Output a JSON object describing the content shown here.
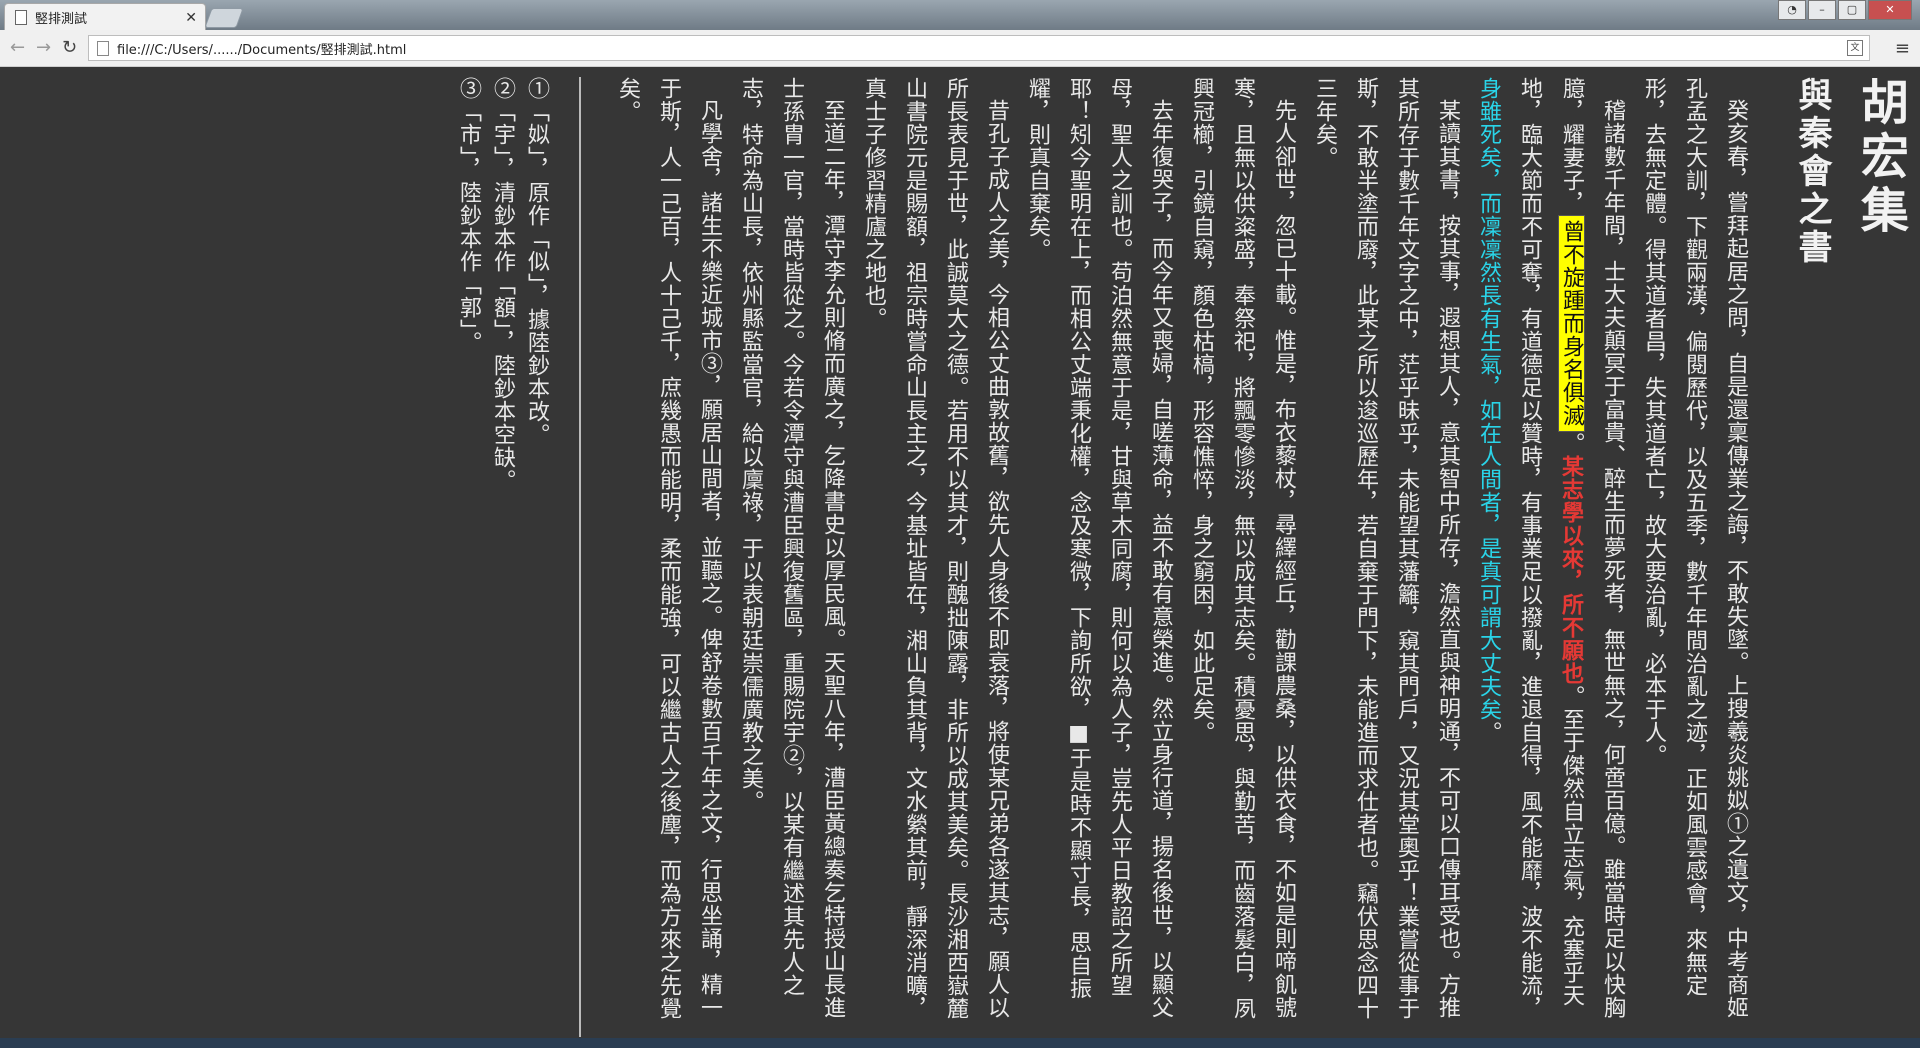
{
  "window": {
    "tab_title": "竪排測試",
    "address": "file:///C:/Users/....../Documents/竪排測試.html"
  },
  "doc": {
    "title": "胡宏集",
    "subtitle": "與秦會之書",
    "p1": "癸亥春，嘗拜起居之問，自是還稟傳業之誨，不敢失墜。上搜羲炎姚姒①之遺文，中考商姬孔孟之大訓，下觀兩漢，偏閱歷代，以及五季，數千年間治亂之迹，正如風雲感會，來無定形，去無定體。得其道者昌，失其道者亡，故大要治亂，必本于人。",
    "p2_a": "稽諸數千年間，士大夫顛冥于富貴、醉生而夢死者，無世無之，何啻百億。雖當時足以快胸臆，耀妻子，",
    "p2_highlight": "曾不旋踵而身名俱滅",
    "p2_b": "。",
    "p2_red": "某志學以來，所不願也",
    "p2_c": "。至于傑然自立志氣，充塞乎天地，臨大節而不可奪，有道德足以贊時，有事業足以撥亂，進退自得，風不能靡，波不能流，",
    "p2_cyan": "身雖死矣，而凜凜然長有生氣，如在人間者，是真可謂大丈夫矣",
    "p2_d": "。",
    "p3": "某讀其書，按其事，遐想其人，意其智中所存，澹然直與神明通，不可以口傳耳受也。方推其所存于數千年文字之中，茫乎昧乎，未能望其藩籬，窺其門戶，又況其堂奧乎！業嘗從事于斯，不敢半塗而廢，此某之所以逡巡歷年，若自棄于門下，未能進而求仕者也。竊伏思念四十三年矣。",
    "p4": "先人卻世，忽已十載。惟是，布衣藜杖，尋繹經丘，勸課農桑，以供衣食，不如是則啼飢號寒，且無以供粢盛，奉祭祀，將飄零慘淡，無以成其志矣。積憂思，與勤苦，而齒落髮白，夙興冠櫛，引鏡自窺，顏色枯槁，形容憔悴，身之窮困，如此足矣。",
    "p5": "去年復哭子，而今年又喪婦，自嗟薄命，益不敢有意榮進。然立身行道，揚名後世，以顯父母，聖人之訓也。苟泊然無意于是，甘與草木同腐，則何以為人子，豈先人平日教詔之所望耶！矧今聖明在上，而相公丈端秉化權，念及寒微，下詢所欲，■于是時不顯寸長，思自振耀，則真自棄矣。",
    "p6": "昔孔子成人之美，今相公丈曲敦故舊，欲先人身後不即衰落，將使某兄弟各遂其志，願人以所長表見于世，此誠莫大之德。若用不以其才，則醜拙陳露，非所以成其美矣。長沙湘西嶽麓山書院元是賜額，祖宗時嘗命山長主之，今基址皆在，湘山負其背，文水縈其前，靜深消曠，真士子修習精廬之地也。",
    "p7": "至道二年，潭守李允則脩而廣之，乞降書史以厚民風。天聖八年，漕臣黃總奏乞特授山長進士孫胄一官，當時皆從之。今若令潭守與漕臣興復舊區，重賜院宇②，以某有繼述其先人之志，特命為山長，依州縣監當官，給以廩祿，于以表朝廷崇儒廣教之美。",
    "p8": "凡學舍，諸生不樂近城市③，願居山間者，並聽之。俾舒卷數百千年之文，行思坐誦，精一于斯，人一己百，人十己千，庶幾愚而能明，柔而能強，可以繼古人之後塵，而為方來之先覺矣。",
    "notes": [
      "①「姒」，原作「似」，據陸鈔本改。",
      "②「宇」，清鈔本作「額」，陸鈔本空缺。",
      "③「市」，陸鈔本作「郭」。"
    ]
  },
  "colors": {
    "highlight": "#ffff00",
    "red": "#e53935",
    "cyan": "#2ad4e8",
    "background": "#363636"
  }
}
